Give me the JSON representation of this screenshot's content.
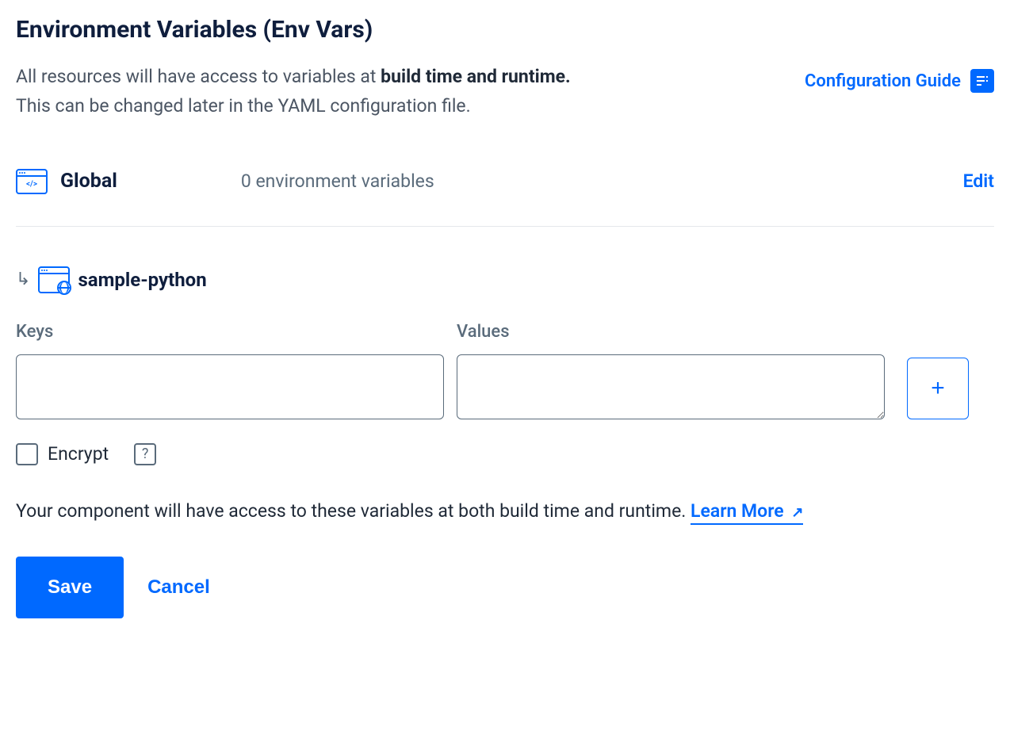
{
  "header": {
    "title": "Environment Variables (Env Vars)",
    "description_prefix": "All resources will have access to variables at ",
    "description_bold": "build time and runtime.",
    "description_line2": "This can be changed later in the YAML configuration file.",
    "config_guide_label": "Configuration Guide"
  },
  "global": {
    "label": "Global",
    "count_text": "0 environment variables",
    "edit_label": "Edit"
  },
  "component": {
    "name": "sample-python"
  },
  "form": {
    "keys_label": "Keys",
    "values_label": "Values",
    "keys_value": "",
    "values_value": "",
    "encrypt_label": "Encrypt",
    "help_symbol": "?",
    "info_text": "Your component will have access to these variables at both build time and runtime. ",
    "learn_more_label": "Learn More"
  },
  "buttons": {
    "save": "Save",
    "cancel": "Cancel"
  }
}
